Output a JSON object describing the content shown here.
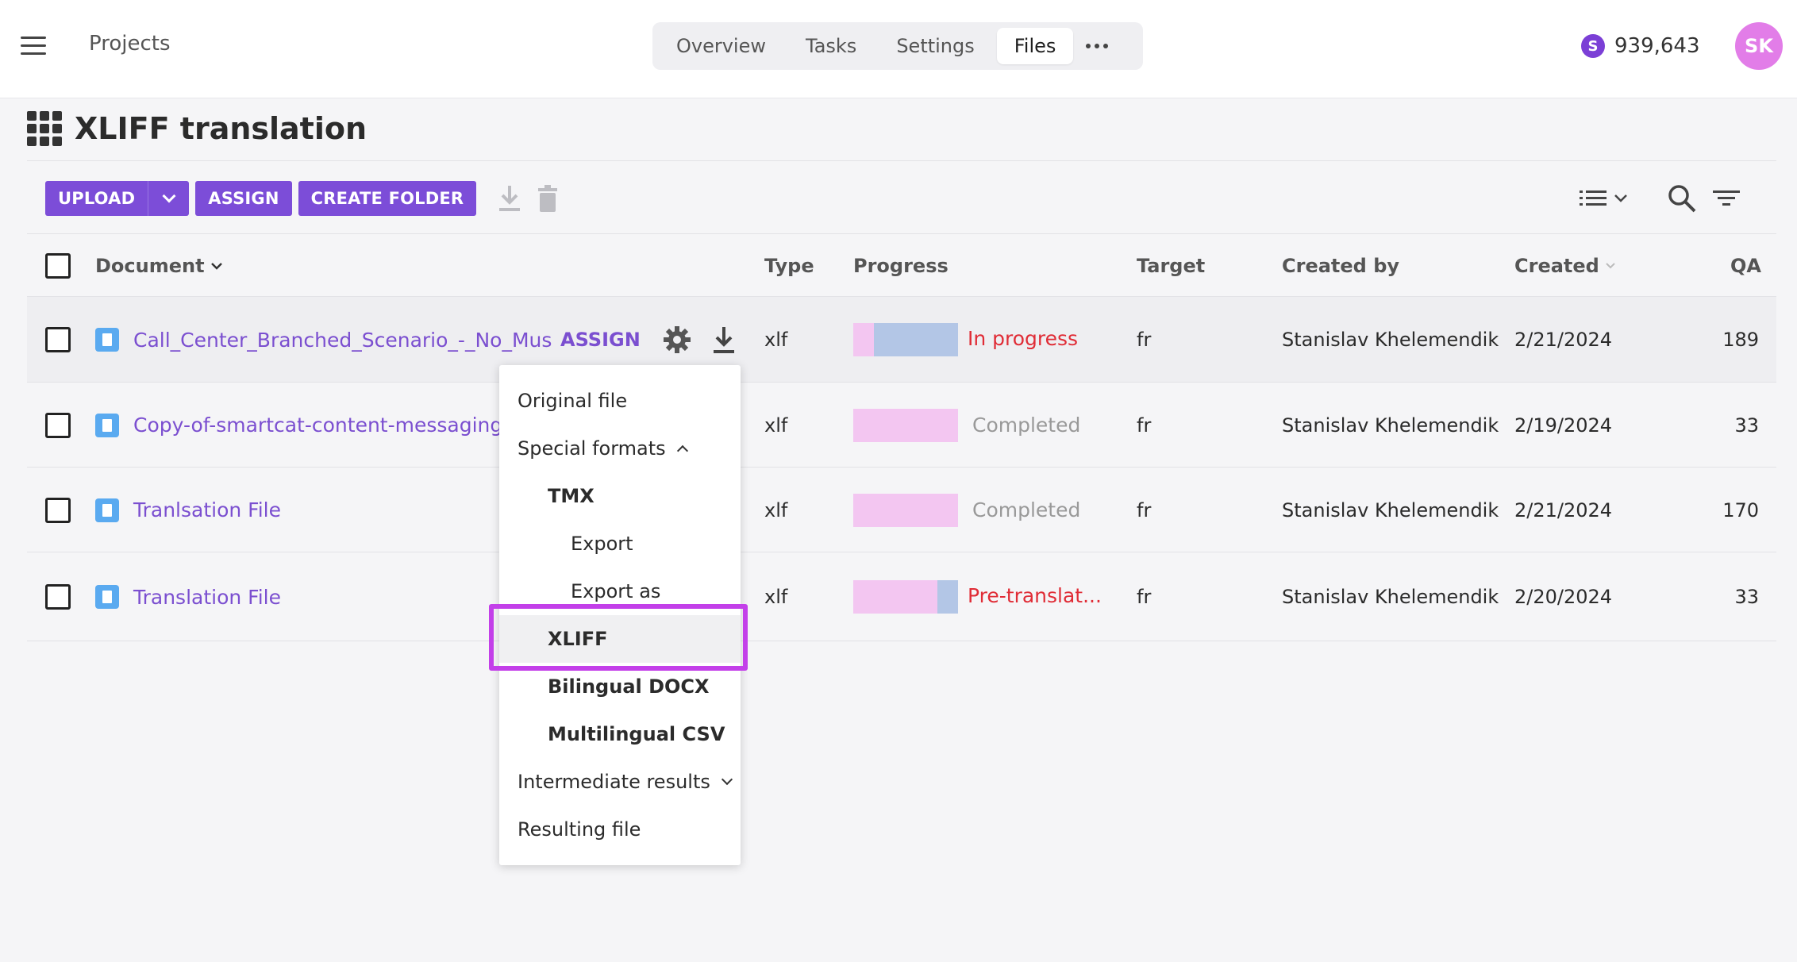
{
  "header": {
    "projects_label": "Projects",
    "tabs": [
      {
        "label": "Overview"
      },
      {
        "label": "Tasks"
      },
      {
        "label": "Settings"
      },
      {
        "label": "Files",
        "active": true
      }
    ],
    "balance_icon_letter": "S",
    "balance": "939,643",
    "avatar_initials": "SK"
  },
  "page": {
    "title": "XLIFF translation"
  },
  "toolbar": {
    "upload_label": "UPLOAD",
    "assign_label": "ASSIGN",
    "create_folder_label": "CREATE FOLDER"
  },
  "table": {
    "columns": {
      "document": "Document",
      "type": "Type",
      "progress": "Progress",
      "target": "Target",
      "created_by": "Created by",
      "created": "Created",
      "qa": "QA"
    },
    "row_assign_label": "ASSIGN",
    "rows": [
      {
        "name": "Call_Center_Branched_Scenario_-_No_Mus",
        "type": "xlf",
        "status": "In progress",
        "target": "fr",
        "created_by": "Stanislav Khelemendik",
        "created": "2/21/2024",
        "qa": "189",
        "progress_pink": 0.2,
        "progress_blue": 0.8
      },
      {
        "name": "Copy-of-smartcat-content-messaging-",
        "type": "xlf",
        "status": "Completed",
        "target": "fr",
        "created_by": "Stanislav Khelemendik",
        "created": "2/19/2024",
        "qa": "33",
        "progress_pink": 1.0,
        "progress_blue": 0.0
      },
      {
        "name": "Tranlsation File",
        "type": "xlf",
        "status": "Completed",
        "target": "fr",
        "created_by": "Stanislav Khelemendik",
        "created": "2/21/2024",
        "qa": "170",
        "progress_pink": 1.0,
        "progress_blue": 0.0
      },
      {
        "name": "Translation File",
        "type": "xlf",
        "status": "Pre-translat...",
        "target": "fr",
        "created_by": "Stanislav Khelemendik",
        "created": "2/20/2024",
        "qa": "33",
        "progress_pink": 0.8,
        "progress_blue": 0.2
      }
    ]
  },
  "download_menu": {
    "original_file": "Original file",
    "special_formats": "Special formats",
    "tmx": "TMX",
    "export": "Export",
    "export_as": "Export as",
    "xliff": "XLIFF",
    "bilingual_docx": "Bilingual DOCX",
    "multilingual_csv": "Multilingual CSV",
    "intermediate_results": "Intermediate results",
    "resulting_file": "Resulting file",
    "selected_item": "XLIFF"
  },
  "colors": {
    "accent": "#7c4dd8",
    "link": "#7b4fd0",
    "status_red": "#e02c36",
    "progress_pink": "#f3c6f1",
    "progress_blue": "#b3c6e6",
    "highlight": "#c33fe9",
    "avatar": "#e27de8"
  }
}
